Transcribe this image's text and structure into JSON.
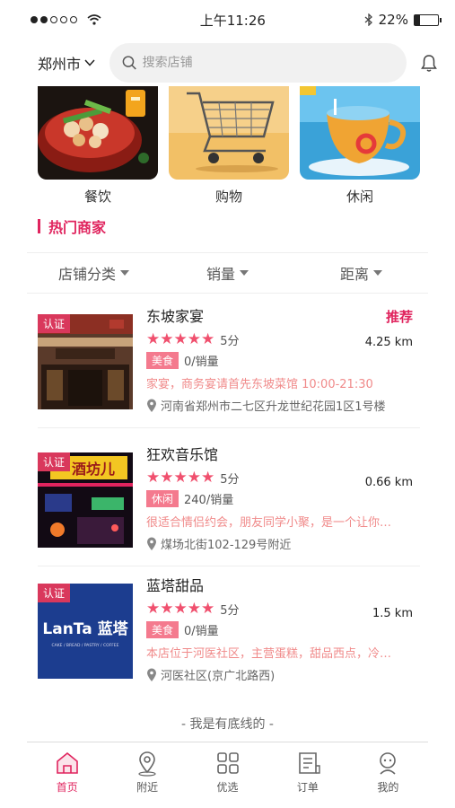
{
  "status": {
    "time": "上午11:26",
    "battery": "22%",
    "battery_level": 0.22
  },
  "header": {
    "city": "郑州市",
    "search_placeholder": "搜索店铺"
  },
  "categories": [
    {
      "label": "餐饮",
      "icon": "hotpot-image"
    },
    {
      "label": "购物",
      "icon": "shopping-cart-image"
    },
    {
      "label": "休闲",
      "icon": "teacup-image"
    }
  ],
  "section_title": "热门商家",
  "filters": [
    {
      "label": "店铺分类"
    },
    {
      "label": "销量"
    },
    {
      "label": "距离"
    }
  ],
  "stores": [
    {
      "badge": "认证",
      "name": "东坡家宴",
      "recommend": "推荐",
      "distance": "4.25 km",
      "stars": "★★★★★",
      "score": "5分",
      "tag": "美食",
      "sales": "0/销量",
      "desc": "家宴，商务宴请首先东坡菜馆 10:00-21:30",
      "address": "河南省郑州市二七区升龙世纪花园1区1号楼"
    },
    {
      "badge": "认证",
      "name": "狂欢音乐馆",
      "distance": "0.66 km",
      "stars": "★★★★★",
      "score": "5分",
      "tag": "休闲",
      "sales": "240/销量",
      "desc": "很适合情侣约会，朋友同学小聚，是一个让你…",
      "address": "煤场北街102-129号附近",
      "sign_text": "酒坊儿"
    },
    {
      "badge": "认证",
      "name": "蓝塔甜品",
      "distance": "1.5 km",
      "stars": "★★★★★",
      "score": "5分",
      "tag": "美食",
      "sales": "0/销量",
      "desc": "本店位于河医社区，主营蛋糕，甜品西点，冷…",
      "address": "河医社区(京广北路西)",
      "logo_main": "LanTa 蓝塔",
      "logo_sub": "CAKE / BREAD / PASTRY / COFFEE"
    }
  ],
  "bottom_text": "- 我是有底线的 -",
  "tabs": [
    {
      "label": "首页",
      "icon": "home-icon",
      "active": true
    },
    {
      "label": "附近",
      "icon": "location-pin-icon"
    },
    {
      "label": "优选",
      "icon": "grid-icon"
    },
    {
      "label": "订单",
      "icon": "order-list-icon"
    },
    {
      "label": "我的",
      "icon": "user-icon"
    }
  ],
  "colors": {
    "accent": "#e0245e",
    "star": "#f0506e",
    "tag": "#f47a8e",
    "desc": "#f08a8a"
  }
}
